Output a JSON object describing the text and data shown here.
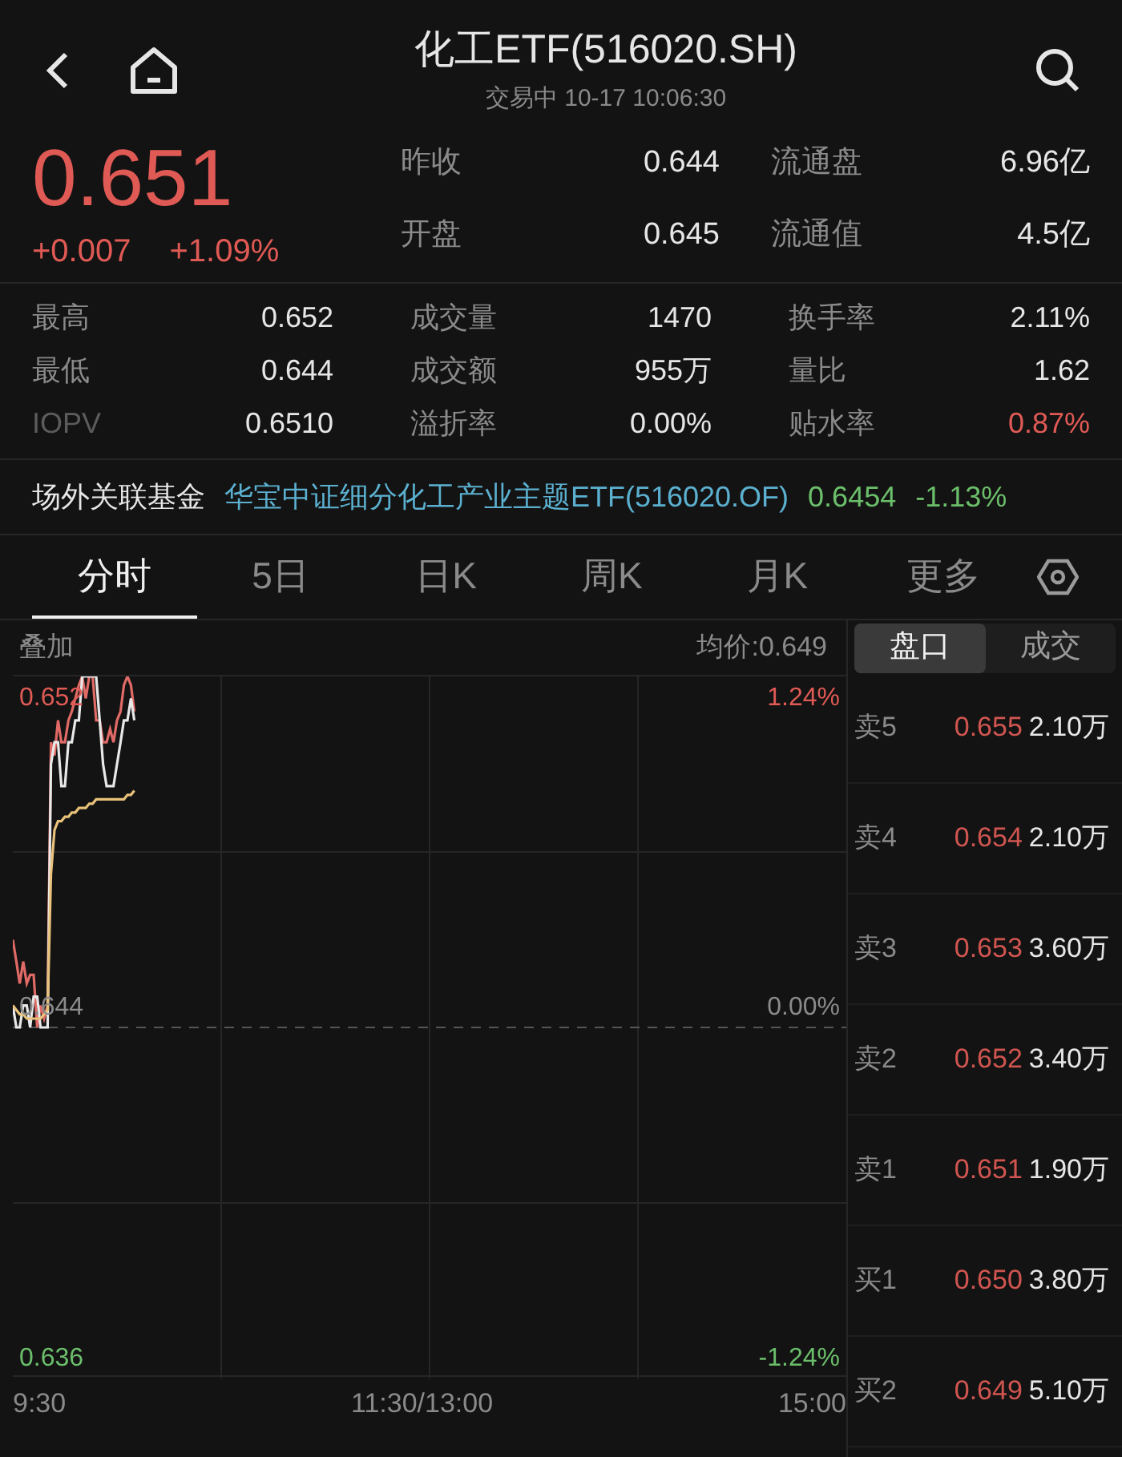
{
  "header": {
    "title": "化工ETF(516020.SH)",
    "subtitle": "交易中 10-17 10:06:30"
  },
  "quote": {
    "price": "0.651",
    "change": "+0.007",
    "change_pct": "+1.09%",
    "color": "#e05a55"
  },
  "quote_stats": [
    {
      "label": "昨收",
      "value": "0.644"
    },
    {
      "label": "流通盘",
      "value": "6.96亿"
    },
    {
      "label": "开盘",
      "value": "0.645"
    },
    {
      "label": "流通值",
      "value": "4.5亿"
    }
  ],
  "stats": [
    {
      "label": "最高",
      "value": "0.652",
      "color": "#e6e6e6",
      "dim": false
    },
    {
      "label": "成交量",
      "value": "1470",
      "color": "#e6e6e6",
      "dim": false
    },
    {
      "label": "换手率",
      "value": "2.11%",
      "color": "#e6e6e6",
      "dim": false
    },
    {
      "label": "最低",
      "value": "0.644",
      "color": "#e6e6e6",
      "dim": false
    },
    {
      "label": "成交额",
      "value": "955万",
      "color": "#e6e6e6",
      "dim": false
    },
    {
      "label": "量比",
      "value": "1.62",
      "color": "#e6e6e6",
      "dim": false
    },
    {
      "label": "IOPV",
      "value": "0.6510",
      "color": "#e6e6e6",
      "dim": true
    },
    {
      "label": "溢折率",
      "value": "0.00%",
      "color": "#e6e6e6",
      "dim": false
    },
    {
      "label": "贴水率",
      "value": "0.87%",
      "color": "#e05a55",
      "dim": false
    }
  ],
  "linked_fund": {
    "label": "场外关联基金",
    "name": "华宝中证细分化工产业主题ETF(516020.OF)",
    "nav": "0.6454",
    "change": "-1.13%",
    "color": "#6bbf6b"
  },
  "tabs": [
    {
      "label": "分时",
      "selected": true
    },
    {
      "label": "5日",
      "selected": false
    },
    {
      "label": "日K",
      "selected": false
    },
    {
      "label": "周K",
      "selected": false
    },
    {
      "label": "月K",
      "selected": false
    },
    {
      "label": "更多",
      "selected": false
    }
  ],
  "chart_panel": {
    "overlay_label": "叠加",
    "avg_price": "均价:0.649",
    "left_labels": [
      "0.652",
      "0.644",
      "0.636"
    ],
    "right_labels": [
      "1.24%",
      "0.00%",
      "-1.24%"
    ],
    "time_labels": [
      "9:30",
      "11:30/13:00",
      "15:00"
    ]
  },
  "book_tabs": [
    {
      "label": "盘口",
      "selected": true
    },
    {
      "label": "成交",
      "selected": false
    }
  ],
  "order_book": [
    {
      "level": "卖5",
      "price": "0.655",
      "volume": "2.10万"
    },
    {
      "level": "卖4",
      "price": "0.654",
      "volume": "2.10万"
    },
    {
      "level": "卖3",
      "price": "0.653",
      "volume": "3.60万"
    },
    {
      "level": "卖2",
      "price": "0.652",
      "volume": "3.40万"
    },
    {
      "level": "卖1",
      "price": "0.651",
      "volume": "1.90万"
    },
    {
      "level": "买1",
      "price": "0.650",
      "volume": "3.80万"
    },
    {
      "level": "买2",
      "price": "0.649",
      "volume": "5.10万"
    }
  ]
}
